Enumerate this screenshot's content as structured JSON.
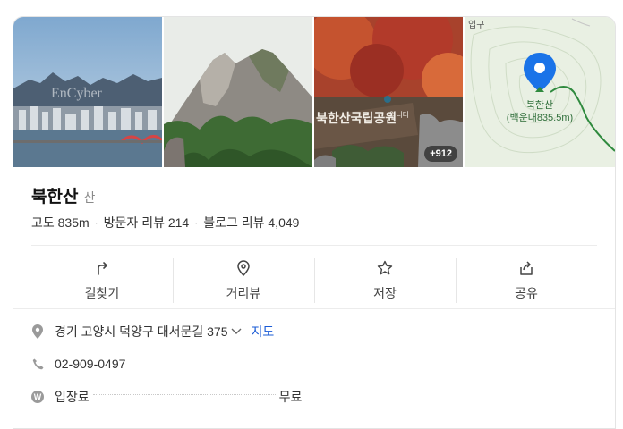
{
  "photos": {
    "city_watermark": "EnCyber",
    "sign_text": "북한산국립공원",
    "sign_small": "입니다",
    "more_count": "+912",
    "map_top_label": "입구",
    "map_place": "북한산",
    "map_peak": "(백운대835.5m)"
  },
  "place": {
    "name": "북한산",
    "category": "산"
  },
  "stats": {
    "altitude": "고도 835m",
    "visitor_reviews": "방문자 리뷰 214",
    "blog_reviews": "블로그 리뷰 4,049"
  },
  "actions": [
    {
      "label": "길찾기",
      "icon": "directions-icon"
    },
    {
      "label": "거리뷰",
      "icon": "street-view-icon"
    },
    {
      "label": "저장",
      "icon": "star-icon"
    },
    {
      "label": "공유",
      "icon": "share-icon"
    }
  ],
  "info": {
    "address": "경기 고양시 덕양구 대서문길 375",
    "map_link": "지도",
    "phone": "02-909-0497",
    "fee_label": "입장료",
    "fee_value": "무료",
    "fee_icon_glyph": "W"
  },
  "colors": {
    "link": "#1a5bd6",
    "map_pin": "#1a73e8",
    "map_trail": "#2f8a3e"
  }
}
